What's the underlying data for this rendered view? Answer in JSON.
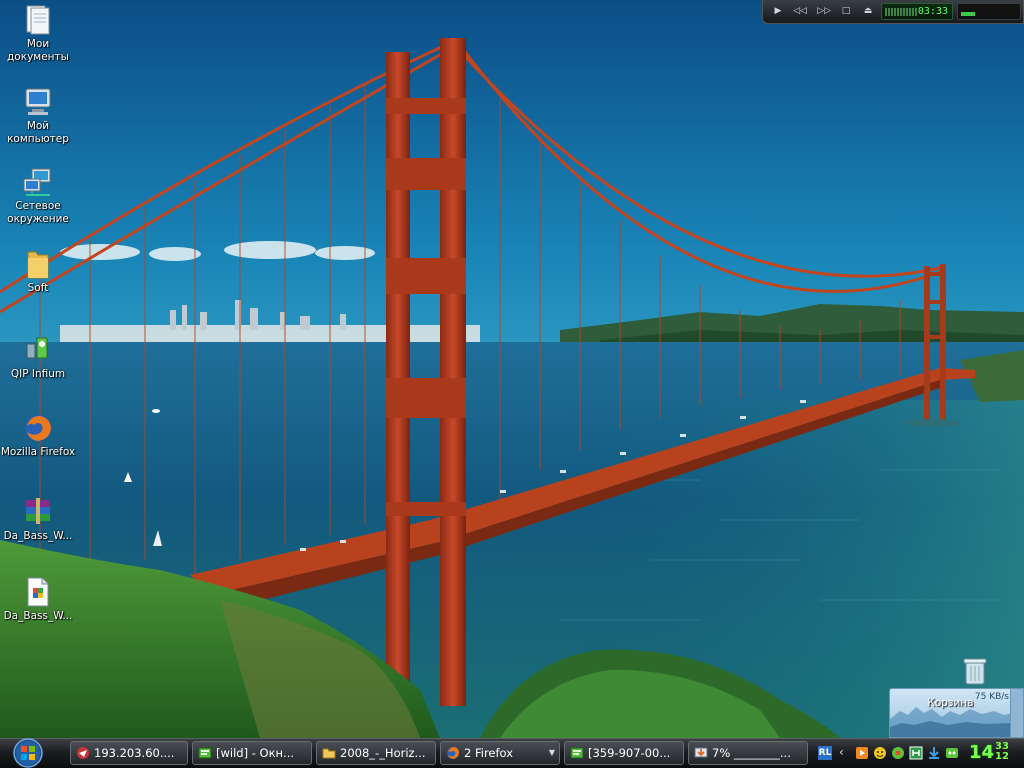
{
  "desktop": {
    "icons": [
      {
        "label": "Мои\nдокументы",
        "icon": "my-documents-icon"
      },
      {
        "label": "Мой\nкомпьютер",
        "icon": "my-computer-icon"
      },
      {
        "label": "Сетевое\nокружение",
        "icon": "network-places-icon"
      },
      {
        "label": "Soft",
        "icon": "folder-icon"
      },
      {
        "label": "QIP Infium",
        "icon": "qip-infium-icon"
      },
      {
        "label": "Mozilla Firefox",
        "icon": "firefox-icon"
      },
      {
        "label": "Da_Bass_W...",
        "icon": "winrar-archive-icon"
      },
      {
        "label": "Da_Bass_W...",
        "icon": "document-file-icon"
      }
    ],
    "recycle_bin": {
      "label": "Корзина",
      "icon": "recycle-bin-icon"
    }
  },
  "media_player": {
    "buttons": [
      "play",
      "previous",
      "next",
      "stop",
      "eject"
    ],
    "time": "03:33",
    "volume_fraction": 0.25
  },
  "traffic_gadget": {
    "speed": "75 KB/s"
  },
  "taskbar": {
    "start_icon": "windows-logo-icon",
    "tasks": [
      {
        "label": "193.203.60....",
        "icon": "ftp-client-icon"
      },
      {
        "label": "[wild] - Окн...",
        "icon": "chat-window-icon"
      },
      {
        "label": "2008_-_Horiz...",
        "icon": "folder-icon"
      },
      {
        "label": "2 Firefox",
        "icon": "firefox-icon",
        "grouped": true
      },
      {
        "label": "[359-907-00...",
        "icon": "chat-window-icon"
      },
      {
        "label": "7% ________...",
        "icon": "download-icon"
      }
    ],
    "tray": {
      "language": "RL",
      "icons": [
        "media-player-tray-icon",
        "qip-tray-icon",
        "icq-tray-icon",
        "calendar-tray-icon",
        "download-tray-icon",
        "messenger-tray-icon"
      ],
      "clock_hours": "14",
      "clock_minutes": "33\n12"
    }
  }
}
